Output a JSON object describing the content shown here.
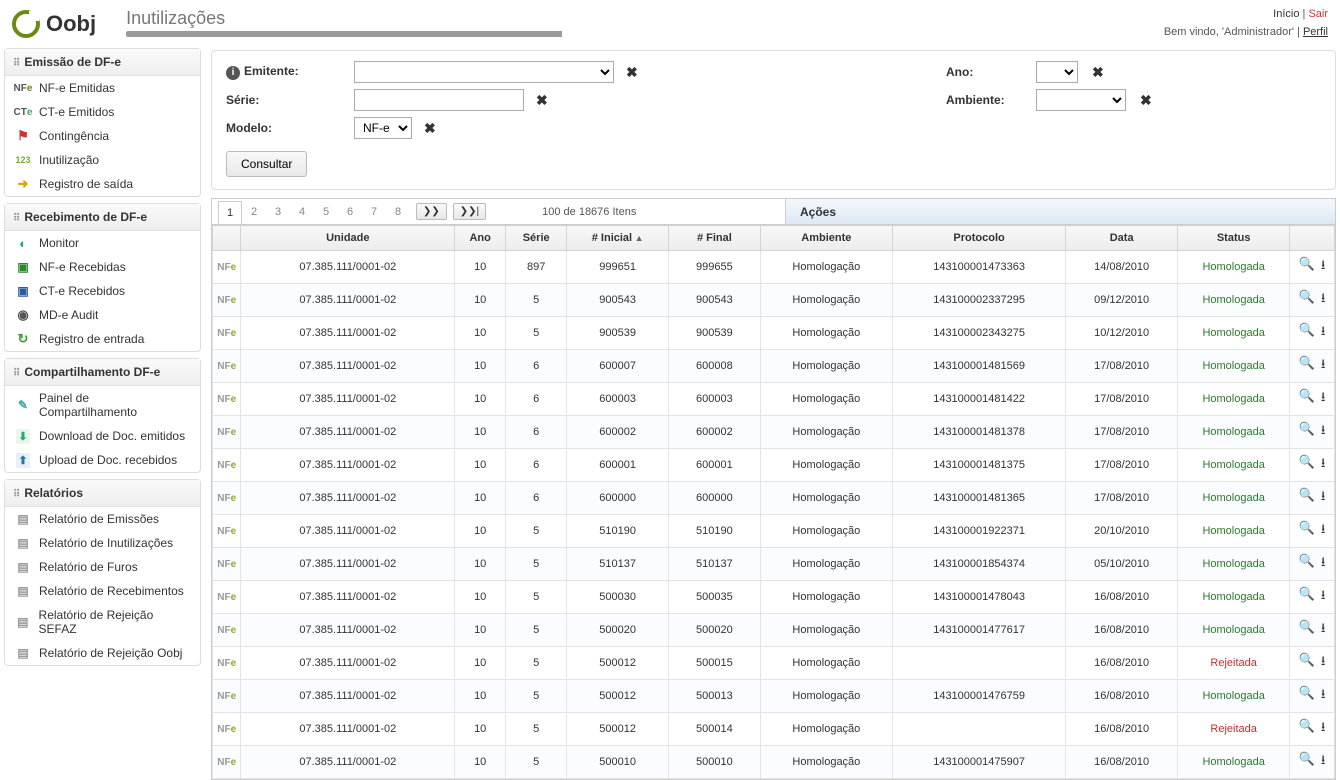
{
  "brand": "Oobj",
  "pageTitle": "Inutilizações",
  "topRight": {
    "inicio": "Início",
    "sair": "Sair",
    "welcome": "Bem vindo, 'Administrador' | ",
    "perfil": "Perfil"
  },
  "sidebar": [
    {
      "title": "Emissão de DF-e",
      "items": [
        {
          "icon": "ic-nfe",
          "label": "NF-e Emitidas"
        },
        {
          "icon": "ic-cte",
          "label": "CT-e Emitidos"
        },
        {
          "icon": "ic-warn",
          "label": "Contingência"
        },
        {
          "icon": "ic-123",
          "label": "Inutilização"
        },
        {
          "icon": "ic-arrow-out",
          "label": "Registro de saída"
        }
      ]
    },
    {
      "title": "Recebimento de DF-e",
      "items": [
        {
          "icon": "ic-pie",
          "label": "Monitor"
        },
        {
          "icon": "ic-inbox-g",
          "label": "NF-e Recebidas"
        },
        {
          "icon": "ic-inbox-b",
          "label": "CT-e Recebidos"
        },
        {
          "icon": "ic-audit",
          "label": "MD-e Audit"
        },
        {
          "icon": "ic-arrow-in",
          "label": "Registro de entrada"
        }
      ]
    },
    {
      "title": "Compartilhamento DF-e",
      "items": [
        {
          "icon": "ic-share",
          "label": "Painel de Compartilhamento"
        },
        {
          "icon": "ic-dl",
          "label": "Download de Doc. emitidos"
        },
        {
          "icon": "ic-ul",
          "label": "Upload de Doc. recebidos"
        }
      ]
    },
    {
      "title": "Relatórios",
      "items": [
        {
          "icon": "ic-report",
          "label": "Relatório de Emissões"
        },
        {
          "icon": "ic-report",
          "label": "Relatório de Inutilizações"
        },
        {
          "icon": "ic-report",
          "label": "Relatório de Furos"
        },
        {
          "icon": "ic-report",
          "label": "Relatório de Recebimentos"
        },
        {
          "icon": "ic-report",
          "label": "Relatório de Rejeição SEFAZ"
        },
        {
          "icon": "ic-report",
          "label": "Relatório de Rejeição Oobj"
        }
      ]
    }
  ],
  "filters": {
    "emitente": {
      "label": "Emitente:",
      "value": ""
    },
    "serie": {
      "label": "Série:",
      "value": ""
    },
    "modelo": {
      "label": "Modelo:",
      "value": "NF-e"
    },
    "ano": {
      "label": "Ano:",
      "value": ""
    },
    "ambiente": {
      "label": "Ambiente:",
      "value": ""
    },
    "consultar": "Consultar"
  },
  "pager": {
    "pages": [
      "1",
      "2",
      "3",
      "4",
      "5",
      "6",
      "7",
      "8"
    ],
    "next": "❯❯",
    "last": "❯❯|",
    "info": "100 de 18676 Itens",
    "acoes": "Ações"
  },
  "columns": {
    "unidade": "Unidade",
    "ano": "Ano",
    "serie": "Série",
    "inicial": "# Inicial",
    "final": "# Final",
    "ambiente": "Ambiente",
    "protocolo": "Protocolo",
    "data": "Data",
    "status": "Status"
  },
  "rows": [
    {
      "unidade": "07.385.111/0001-02",
      "ano": "10",
      "serie": "897",
      "ini": "999651",
      "fin": "999655",
      "amb": "Homologação",
      "proto": "143100001473363",
      "data": "14/08/2010",
      "status": "Homologada",
      "sc": "h"
    },
    {
      "unidade": "07.385.111/0001-02",
      "ano": "10",
      "serie": "5",
      "ini": "900543",
      "fin": "900543",
      "amb": "Homologação",
      "proto": "143100002337295",
      "data": "09/12/2010",
      "status": "Homologada",
      "sc": "h"
    },
    {
      "unidade": "07.385.111/0001-02",
      "ano": "10",
      "serie": "5",
      "ini": "900539",
      "fin": "900539",
      "amb": "Homologação",
      "proto": "143100002343275",
      "data": "10/12/2010",
      "status": "Homologada",
      "sc": "h"
    },
    {
      "unidade": "07.385.111/0001-02",
      "ano": "10",
      "serie": "6",
      "ini": "600007",
      "fin": "600008",
      "amb": "Homologação",
      "proto": "143100001481569",
      "data": "17/08/2010",
      "status": "Homologada",
      "sc": "h"
    },
    {
      "unidade": "07.385.111/0001-02",
      "ano": "10",
      "serie": "6",
      "ini": "600003",
      "fin": "600003",
      "amb": "Homologação",
      "proto": "143100001481422",
      "data": "17/08/2010",
      "status": "Homologada",
      "sc": "h"
    },
    {
      "unidade": "07.385.111/0001-02",
      "ano": "10",
      "serie": "6",
      "ini": "600002",
      "fin": "600002",
      "amb": "Homologação",
      "proto": "143100001481378",
      "data": "17/08/2010",
      "status": "Homologada",
      "sc": "h"
    },
    {
      "unidade": "07.385.111/0001-02",
      "ano": "10",
      "serie": "6",
      "ini": "600001",
      "fin": "600001",
      "amb": "Homologação",
      "proto": "143100001481375",
      "data": "17/08/2010",
      "status": "Homologada",
      "sc": "h"
    },
    {
      "unidade": "07.385.111/0001-02",
      "ano": "10",
      "serie": "6",
      "ini": "600000",
      "fin": "600000",
      "amb": "Homologação",
      "proto": "143100001481365",
      "data": "17/08/2010",
      "status": "Homologada",
      "sc": "h"
    },
    {
      "unidade": "07.385.111/0001-02",
      "ano": "10",
      "serie": "5",
      "ini": "510190",
      "fin": "510190",
      "amb": "Homologação",
      "proto": "143100001922371",
      "data": "20/10/2010",
      "status": "Homologada",
      "sc": "h"
    },
    {
      "unidade": "07.385.111/0001-02",
      "ano": "10",
      "serie": "5",
      "ini": "510137",
      "fin": "510137",
      "amb": "Homologação",
      "proto": "143100001854374",
      "data": "05/10/2010",
      "status": "Homologada",
      "sc": "h"
    },
    {
      "unidade": "07.385.111/0001-02",
      "ano": "10",
      "serie": "5",
      "ini": "500030",
      "fin": "500035",
      "amb": "Homologação",
      "proto": "143100001478043",
      "data": "16/08/2010",
      "status": "Homologada",
      "sc": "h"
    },
    {
      "unidade": "07.385.111/0001-02",
      "ano": "10",
      "serie": "5",
      "ini": "500020",
      "fin": "500020",
      "amb": "Homologação",
      "proto": "143100001477617",
      "data": "16/08/2010",
      "status": "Homologada",
      "sc": "h"
    },
    {
      "unidade": "07.385.111/0001-02",
      "ano": "10",
      "serie": "5",
      "ini": "500012",
      "fin": "500015",
      "amb": "Homologação",
      "proto": "",
      "data": "16/08/2010",
      "status": "Rejeitada",
      "sc": "r"
    },
    {
      "unidade": "07.385.111/0001-02",
      "ano": "10",
      "serie": "5",
      "ini": "500012",
      "fin": "500013",
      "amb": "Homologação",
      "proto": "143100001476759",
      "data": "16/08/2010",
      "status": "Homologada",
      "sc": "h"
    },
    {
      "unidade": "07.385.111/0001-02",
      "ano": "10",
      "serie": "5",
      "ini": "500012",
      "fin": "500014",
      "amb": "Homologação",
      "proto": "",
      "data": "16/08/2010",
      "status": "Rejeitada",
      "sc": "r"
    },
    {
      "unidade": "07.385.111/0001-02",
      "ano": "10",
      "serie": "5",
      "ini": "500010",
      "fin": "500010",
      "amb": "Homologação",
      "proto": "143100001475907",
      "data": "16/08/2010",
      "status": "Homologada",
      "sc": "h"
    }
  ]
}
